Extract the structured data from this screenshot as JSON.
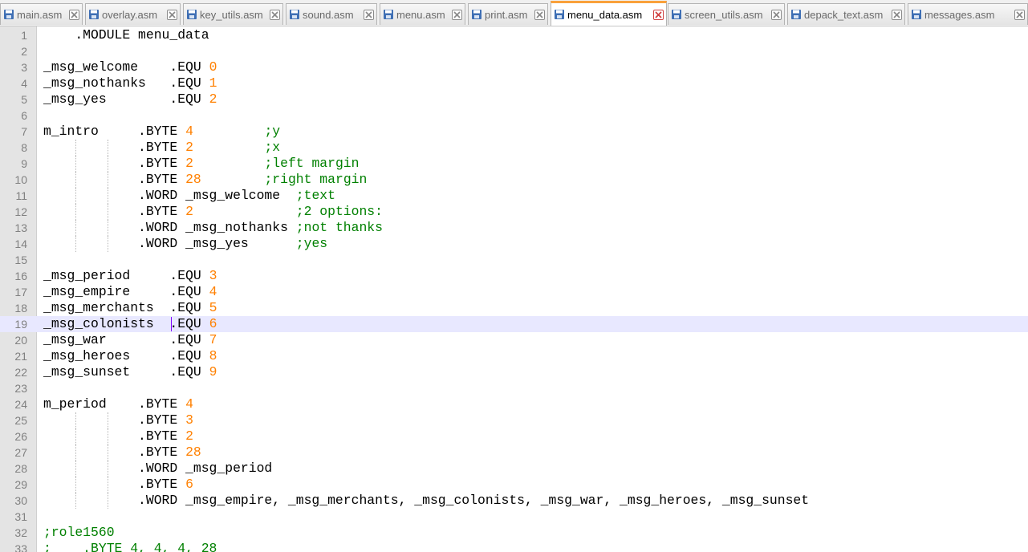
{
  "colors": {
    "active_tab_accent": "#f9a13b",
    "number": "#ff8000",
    "comment": "#008000",
    "current_line": "#e8e8ff",
    "caret": "#8000ff",
    "close_active": "#d04040",
    "close_inactive": "#8a8a8a",
    "file_icon": "#3f6fb4"
  },
  "tabs": [
    {
      "label": "main.asm",
      "icon": "saved-file-icon",
      "active": false
    },
    {
      "label": "overlay.asm",
      "icon": "saved-file-icon",
      "active": false
    },
    {
      "label": "key_utils.asm",
      "icon": "saved-file-icon",
      "active": false
    },
    {
      "label": "sound.asm",
      "icon": "saved-file-icon",
      "active": false
    },
    {
      "label": "menu.asm",
      "icon": "saved-file-icon",
      "active": false
    },
    {
      "label": "print.asm",
      "icon": "saved-file-icon",
      "active": false
    },
    {
      "label": "menu_data.asm",
      "icon": "saved-file-icon",
      "active": true
    },
    {
      "label": "screen_utils.asm",
      "icon": "saved-file-icon",
      "active": false
    },
    {
      "label": "depack_text.asm",
      "icon": "saved-file-icon",
      "active": false
    },
    {
      "label": "messages.asm",
      "icon": "saved-file-icon",
      "active": false
    }
  ],
  "editor": {
    "current_line": 19,
    "lines": [
      {
        "number": "1",
        "tokens": [
          [
            "p",
            "    .MODULE menu_data"
          ]
        ]
      },
      {
        "number": "2",
        "tokens": []
      },
      {
        "number": "3",
        "tokens": [
          [
            "p",
            "_msg_welcome    .EQU "
          ],
          [
            "n",
            "0"
          ]
        ]
      },
      {
        "number": "4",
        "tokens": [
          [
            "p",
            "_msg_nothanks   .EQU "
          ],
          [
            "n",
            "1"
          ]
        ]
      },
      {
        "number": "5",
        "tokens": [
          [
            "p",
            "_msg_yes        .EQU "
          ],
          [
            "n",
            "2"
          ]
        ]
      },
      {
        "number": "6",
        "tokens": []
      },
      {
        "number": "7",
        "tokens": [
          [
            "p",
            "m_intro     .BYTE "
          ],
          [
            "n",
            "4"
          ],
          [
            "p",
            "         "
          ],
          [
            "c",
            ";y"
          ]
        ]
      },
      {
        "number": "8",
        "tokens": [
          [
            "p",
            "            .BYTE "
          ],
          [
            "n",
            "2"
          ],
          [
            "p",
            "         "
          ],
          [
            "c",
            ";x"
          ]
        ]
      },
      {
        "number": "9",
        "tokens": [
          [
            "p",
            "            .BYTE "
          ],
          [
            "n",
            "2"
          ],
          [
            "p",
            "         "
          ],
          [
            "c",
            ";left margin"
          ]
        ]
      },
      {
        "number": "10",
        "tokens": [
          [
            "p",
            "            .BYTE "
          ],
          [
            "n",
            "28"
          ],
          [
            "p",
            "        "
          ],
          [
            "c",
            ";right margin"
          ]
        ]
      },
      {
        "number": "11",
        "tokens": [
          [
            "p",
            "            .WORD _msg_welcome  "
          ],
          [
            "c",
            ";text"
          ]
        ]
      },
      {
        "number": "12",
        "tokens": [
          [
            "p",
            "            .BYTE "
          ],
          [
            "n",
            "2"
          ],
          [
            "p",
            "             "
          ],
          [
            "c",
            ";2 options:"
          ]
        ]
      },
      {
        "number": "13",
        "tokens": [
          [
            "p",
            "            .WORD _msg_nothanks "
          ],
          [
            "c",
            ";not thanks"
          ]
        ]
      },
      {
        "number": "14",
        "tokens": [
          [
            "p",
            "            .WORD _msg_yes      "
          ],
          [
            "c",
            ";yes"
          ]
        ]
      },
      {
        "number": "15",
        "tokens": []
      },
      {
        "number": "16",
        "tokens": [
          [
            "p",
            "_msg_period     .EQU "
          ],
          [
            "n",
            "3"
          ]
        ]
      },
      {
        "number": "17",
        "tokens": [
          [
            "p",
            "_msg_empire     .EQU "
          ],
          [
            "n",
            "4"
          ]
        ]
      },
      {
        "number": "18",
        "tokens": [
          [
            "p",
            "_msg_merchants  .EQU "
          ],
          [
            "n",
            "5"
          ]
        ]
      },
      {
        "number": "19",
        "tokens": [
          [
            "p",
            "_msg_colonists  .EQU "
          ],
          [
            "n",
            "6"
          ]
        ]
      },
      {
        "number": "20",
        "tokens": [
          [
            "p",
            "_msg_war        .EQU "
          ],
          [
            "n",
            "7"
          ]
        ]
      },
      {
        "number": "21",
        "tokens": [
          [
            "p",
            "_msg_heroes     .EQU "
          ],
          [
            "n",
            "8"
          ]
        ]
      },
      {
        "number": "22",
        "tokens": [
          [
            "p",
            "_msg_sunset     .EQU "
          ],
          [
            "n",
            "9"
          ]
        ]
      },
      {
        "number": "23",
        "tokens": []
      },
      {
        "number": "24",
        "tokens": [
          [
            "p",
            "m_period    .BYTE "
          ],
          [
            "n",
            "4"
          ]
        ]
      },
      {
        "number": "25",
        "tokens": [
          [
            "p",
            "            .BYTE "
          ],
          [
            "n",
            "3"
          ]
        ]
      },
      {
        "number": "26",
        "tokens": [
          [
            "p",
            "            .BYTE "
          ],
          [
            "n",
            "2"
          ]
        ]
      },
      {
        "number": "27",
        "tokens": [
          [
            "p",
            "            .BYTE "
          ],
          [
            "n",
            "28"
          ]
        ]
      },
      {
        "number": "28",
        "tokens": [
          [
            "p",
            "            .WORD _msg_period"
          ]
        ]
      },
      {
        "number": "29",
        "tokens": [
          [
            "p",
            "            .BYTE "
          ],
          [
            "n",
            "6"
          ]
        ]
      },
      {
        "number": "30",
        "tokens": [
          [
            "p",
            "            .WORD _msg_empire, _msg_merchants, _msg_colonists, _msg_war, _msg_heroes, _msg_sunset"
          ]
        ]
      },
      {
        "number": "31",
        "tokens": []
      },
      {
        "number": "32",
        "tokens": [
          [
            "c",
            ";role1560"
          ]
        ]
      },
      {
        "number": "33",
        "tokens": [
          [
            "c",
            ";    .BYTE 4, 4, 4, 28"
          ]
        ]
      }
    ]
  }
}
